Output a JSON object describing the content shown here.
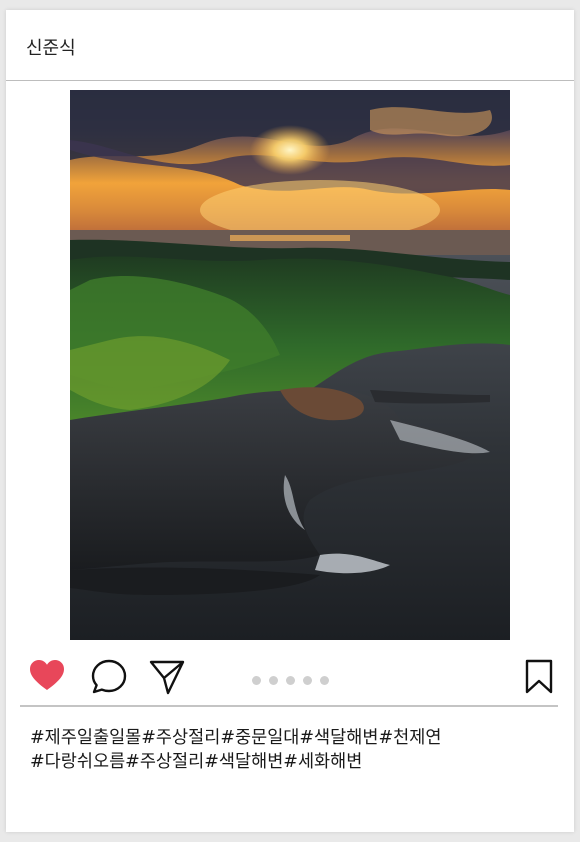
{
  "post": {
    "username": "신준식",
    "image_alt": "Jeju coastal cliffs at sunset",
    "carousel_count": 5,
    "caption_lines": [
      "#제주일출일몰#주상절리#중문일대#색달해변#천제연",
      "#다랑쉬오름#주상절리#색달해변#세화해변"
    ]
  },
  "icons": {
    "like": "heart-icon",
    "comment": "comment-icon",
    "share": "send-icon",
    "save": "bookmark-icon"
  },
  "colors": {
    "like": "#e8475a",
    "dot": "#cfcfcf",
    "divider": "#c4c4c4"
  }
}
